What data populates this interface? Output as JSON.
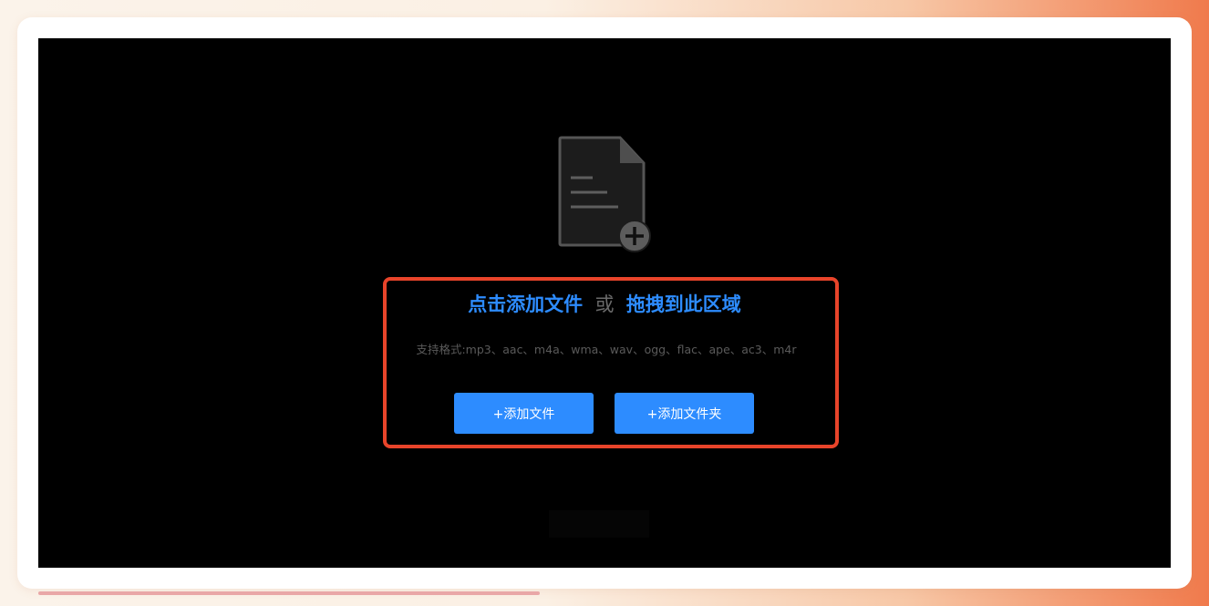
{
  "upload": {
    "headline_click": "点击添加文件",
    "headline_or": "或",
    "headline_drag": "拖拽到此区域",
    "formats": "支持格式:mp3、aac、m4a、wma、wav、ogg、flac、ape、ac3、m4r",
    "add_file_label": "+添加文件",
    "add_folder_label": "+添加文件夹"
  },
  "icons": {
    "file_add": "file-add-icon"
  },
  "colors": {
    "accent": "#2d8cff",
    "highlight": "#e8442a",
    "screen_bg": "#000000"
  }
}
